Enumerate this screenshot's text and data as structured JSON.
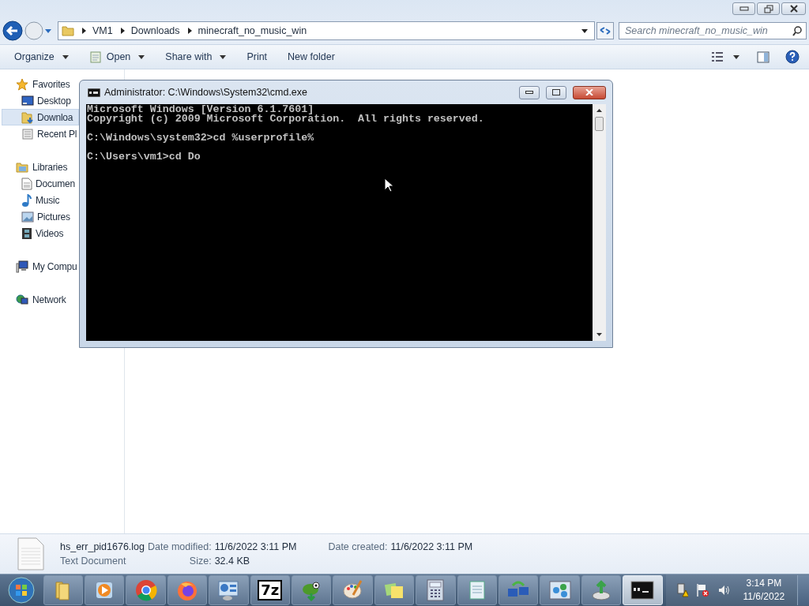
{
  "explorer": {
    "breadcrumb": [
      "VM1",
      "Downloads",
      "minecraft_no_music_win"
    ],
    "search": {
      "placeholder": "Search minecraft_no_music_win"
    },
    "toolbar": [
      {
        "label": "Organize",
        "kind": "menu",
        "dropdown": true
      },
      {
        "label": "Open",
        "kind": "open",
        "dropdown": true
      },
      {
        "label": "Share with",
        "kind": "menu",
        "dropdown": true
      },
      {
        "label": "Print",
        "kind": "menu",
        "dropdown": false
      },
      {
        "label": "New folder",
        "kind": "menu",
        "dropdown": false
      }
    ],
    "sidebar": [
      {
        "label": "Favorites",
        "kind": "star",
        "children": [
          {
            "label": "Desktop",
            "kind": "desktop",
            "selected": false
          },
          {
            "label": "Downloa",
            "kind": "downloads",
            "selected": true
          },
          {
            "label": "Recent Pl",
            "kind": "recent",
            "selected": false
          }
        ]
      },
      {
        "label": "Libraries",
        "kind": "library",
        "children": [
          {
            "label": "Documen",
            "kind": "document",
            "selected": false
          },
          {
            "label": "Music",
            "kind": "music",
            "selected": false
          },
          {
            "label": "Pictures",
            "kind": "pictures",
            "selected": false
          },
          {
            "label": "Videos",
            "kind": "videos",
            "selected": false
          }
        ]
      },
      {
        "label": "My Compu",
        "kind": "computer"
      },
      {
        "label": "Network",
        "kind": "network"
      }
    ],
    "details": {
      "name": "hs_err_pid1676.log",
      "type": "Text Document",
      "fields": [
        {
          "label": "Date modified:",
          "value": "11/6/2022 3:11 PM"
        },
        {
          "label": "Date created:",
          "value": "11/6/2022 3:11 PM"
        },
        {
          "label": "Size:",
          "value": "32.4 KB"
        }
      ]
    }
  },
  "cmd": {
    "title": "Administrator: C:\\Windows\\System32\\cmd.exe",
    "paragraphs": [
      [
        "Microsoft Windows [Version 6.1.7601]",
        "Copyright (c) 2009 Microsoft Corporation.  All rights reserved."
      ],
      [
        "C:\\Windows\\system32>cd %userprofile%"
      ],
      [
        "C:\\Users\\vm1>cd Do"
      ]
    ]
  },
  "taskbar": {
    "items": [
      {
        "kind": "folder",
        "active": false
      },
      {
        "kind": "media",
        "active": false
      },
      {
        "kind": "chrome",
        "active": false
      },
      {
        "kind": "firefox",
        "active": false
      },
      {
        "kind": "panel",
        "active": false
      },
      {
        "kind": "sevenzip",
        "label": "7z",
        "active": false
      },
      {
        "kind": "chameleon",
        "active": false
      },
      {
        "kind": "paint",
        "active": false
      },
      {
        "kind": "notes",
        "active": false
      },
      {
        "kind": "calculator",
        "active": false
      },
      {
        "kind": "notepad",
        "active": false
      },
      {
        "kind": "sync",
        "active": false
      },
      {
        "kind": "molecule",
        "active": false
      },
      {
        "kind": "installer",
        "active": false
      },
      {
        "kind": "console",
        "active": true
      }
    ],
    "time": "3:14 PM",
    "date": "11/6/2022"
  }
}
